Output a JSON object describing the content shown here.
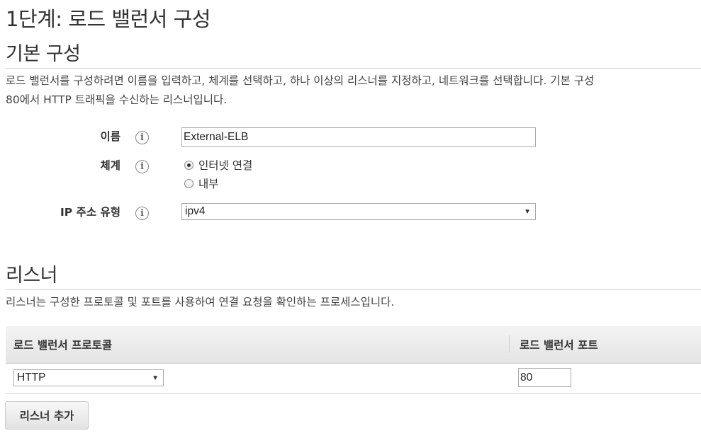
{
  "page": {
    "step_title": "1단계: 로드 밸런서 구성",
    "basic_section_title": "기본 구성",
    "basic_description_line1": "로드 밸런서를 구성하려면 이름을 입력하고, 체계를 선택하고, 하나 이상의 리스너를 지정하고, 네트워크를 선택합니다. 기본 구성",
    "basic_description_line2": "80에서 HTTP 트래픽을 수신하는 리스너입니다."
  },
  "form": {
    "name_label": "이름",
    "name_value": "External-ELB",
    "scheme_label": "체계",
    "scheme_options": [
      "인터넷 연결",
      "내부"
    ],
    "scheme_selected": "인터넷 연결",
    "ip_type_label": "IP 주소 유형",
    "ip_type_value": "ipv4",
    "info_icon": "i"
  },
  "listeners": {
    "section_title": "리스너",
    "description": "리스너는 구성한 프로토콜 및 포트를 사용하여 연결 요청을 확인하는 프로세스입니다.",
    "columns": [
      "로드 밸런서 프로토콜",
      "로드 밸런서 포트"
    ],
    "rows": [
      {
        "protocol": "HTTP",
        "port": "80"
      }
    ],
    "add_button": "리스너 추가"
  }
}
